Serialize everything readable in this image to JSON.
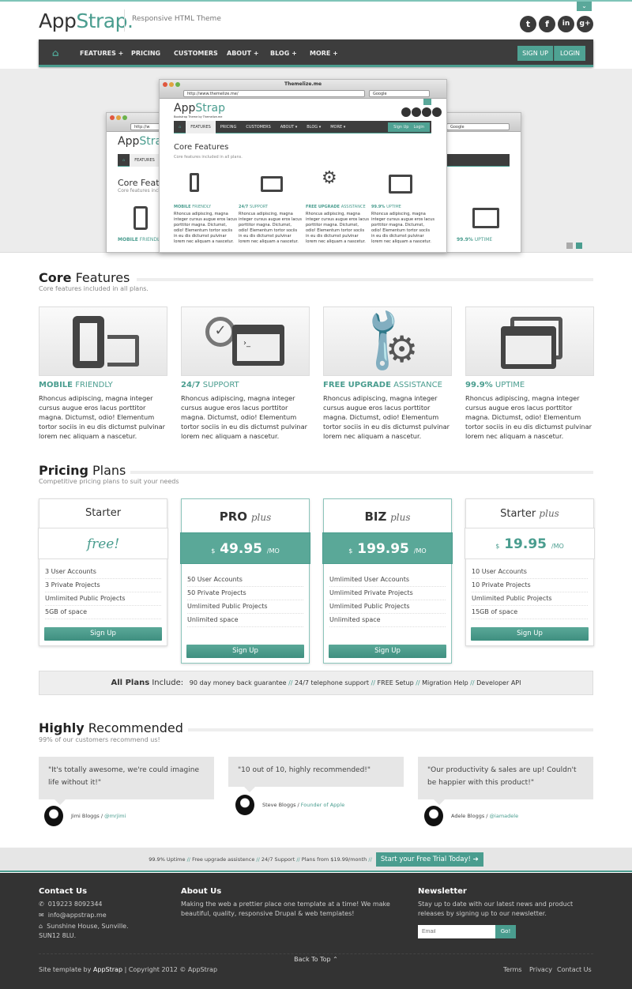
{
  "brand": {
    "logo_a": "App",
    "logo_b": "Strap.",
    "tagline": "Responsive HTML Theme",
    "accent": "#4a9d8f"
  },
  "social": [
    {
      "icon": "twitter-icon",
      "glyph": "t"
    },
    {
      "icon": "facebook-icon",
      "glyph": "f"
    },
    {
      "icon": "linkedin-icon",
      "glyph": "in"
    },
    {
      "icon": "googleplus-icon",
      "glyph": "g+"
    }
  ],
  "nav": {
    "items": [
      "FEATURES +",
      "PRICING",
      "CUSTOMERS",
      "ABOUT +",
      "BLOG +",
      "MORE +"
    ],
    "signup": "SIGN UP",
    "login": "LOGIN"
  },
  "hero": {
    "window_title": "Themelize.me",
    "url": "http://www.themelize.me/",
    "search": "Google",
    "mini_logo_a": "App",
    "mini_logo_b": "Strap",
    "mini_tagline": "Bootstrap Theme by Themelize.me",
    "mini_nav": [
      "FEATURES",
      "PRICING",
      "CUSTOMERS",
      "ABOUT ▾",
      "BLOG ▾",
      "MORE ▾"
    ],
    "mini_signup": "Sign Up",
    "mini_login": "Login",
    "mini_heading": "Core Features",
    "mini_sub": "Core features included in all plans.",
    "mini_features": [
      {
        "a": "MOBILE",
        "b": "FRIENDLY"
      },
      {
        "a": "24/7",
        "b": "SUPPORT"
      },
      {
        "a": "FREE UPGRADE",
        "b": "ASSISTANCE"
      },
      {
        "a": "99.9%",
        "b": "UPTIME"
      }
    ],
    "mini_text": "Rhoncus adipiscing, magna integer cursus augue eros lacus porttitor magna. Dictumst, odio! Elementum tortor sociis in eu dis dictumst pulvinar lorem nec aliquam a nascetur.",
    "back_url": "http://w",
    "back_heading": "Core Featu",
    "back_sub": "Core features includ",
    "back_nav": "FEATURES",
    "back_feature_a": "MOBILE",
    "back_feature_b": "FRIENDLY",
    "back_right_feature_a": "99.9%",
    "back_right_feature_b": "UPTIME",
    "slides": 2,
    "active_slide": 2
  },
  "features": {
    "title_a": "Core",
    "title_b": "Features",
    "subtitle": "Core features included in all plans.",
    "items": [
      {
        "icon": "mobile-tablet-icon",
        "a": "MOBILE",
        "b": "FRIENDLY",
        "text": "Rhoncus adipiscing, magna integer cursus augue eros lacus porttitor magna. Dictumst, odio! Elementum tortor sociis in eu dis dictumst pulvinar lorem nec aliquam a nascetur."
      },
      {
        "icon": "clock-terminal-icon",
        "a": "24/7",
        "b": "SUPPORT",
        "text": "Rhoncus adipiscing, magna integer cursus augue eros lacus porttitor magna. Dictumst, odio! Elementum tortor sociis in eu dis dictumst pulvinar lorem nec aliquam a nascetur."
      },
      {
        "icon": "wrench-gear-icon",
        "a": "FREE UPGRADE",
        "b": "ASSISTANCE",
        "text": "Rhoncus adipiscing, magna integer cursus augue eros lacus porttitor magna. Dictumst, odio! Elementum tortor sociis in eu dis dictumst pulvinar lorem nec aliquam a nascetur."
      },
      {
        "icon": "browser-windows-icon",
        "a": "99.9%",
        "b": "UPTIME",
        "text": "Rhoncus adipiscing, magna integer cursus augue eros lacus porttitor magna. Dictumst, odio! Elementum tortor sociis in eu dis dictumst pulvinar lorem nec aliquam a nascetur."
      }
    ]
  },
  "pricing": {
    "title_a": "Pricing",
    "title_b": "Plans",
    "subtitle": "Competitive pricing plans to suit your needs",
    "plans": [
      {
        "name": "Starter",
        "plus": "",
        "price": "free!",
        "currency": "",
        "per": "",
        "featured": false,
        "features": [
          "3 User Accounts",
          "3 Private Projects",
          "Umlimited Public Projects",
          "5GB of space"
        ],
        "button": "Sign Up"
      },
      {
        "name": "PRO",
        "plus": "plus",
        "price": "49.95",
        "currency": "$",
        "per": "/MO",
        "featured": true,
        "features": [
          "50 User Accounts",
          "50 Private Projects",
          "Umlimited Public Projects",
          "Unlimited space"
        ],
        "button": "Sign Up"
      },
      {
        "name": "BIZ",
        "plus": "plus",
        "price": "199.95",
        "currency": "$",
        "per": "/MO",
        "featured": true,
        "features": [
          "Umlimited User Accounts",
          "Umlimited Private Projects",
          "Umlimited Public Projects",
          "Unlimited space"
        ],
        "button": "Sign Up"
      },
      {
        "name": "Starter",
        "plus": "plus",
        "price": "19.95",
        "currency": "$",
        "per": "/MO",
        "featured": false,
        "features": [
          "10 User Accounts",
          "10 Private Projects",
          "Umlimited Public Projects",
          "15GB of space"
        ],
        "button": "Sign Up"
      }
    ],
    "all_plans_label_a": "All Plans",
    "all_plans_label_b": " Include:",
    "all_plans": [
      "90 day money back guarantee",
      "24/7 telephone support",
      "FREE Setup",
      "Migration Help",
      "Developer API"
    ],
    "sep": "//"
  },
  "testimonials": {
    "title_a": "Highly",
    "title_b": "Recommended",
    "subtitle": "99% of our customers recommend us!",
    "items": [
      {
        "quote": "\"It's totally awesome, we're could imagine life without it!\"",
        "name": "Jimi Bloggs",
        "handle": "@mrjimi"
      },
      {
        "quote": "\"10 out of 10, highly recommended!\"",
        "name": "Steve Bloggs",
        "handle": "Founder of Apple"
      },
      {
        "quote": "\"Our productivity & sales are up! Couldn't be happier with this product!\"",
        "name": "Adele Bloggs",
        "handle": "@iamadele"
      }
    ]
  },
  "cta": {
    "items": [
      "99.9% Uptime",
      "Free upgrade assistence",
      "24/7 Support",
      "Plans from $19.99/month"
    ],
    "button": "Start your Free Trial Today! ➔"
  },
  "footer": {
    "contact_title": "Contact Us",
    "phone": "019223 8092344",
    "email": "info@appstrap.me",
    "address": "Sunshine House, Sunville. SUN12 8LU.",
    "about_title": "About Us",
    "about_text": "Making the web a prettier place one template at a time! We make beautiful, quality, responsive Drupal & web templates!",
    "newsletter_title": "Newsletter",
    "newsletter_text": "Stay up to date with our latest news and product releases by signing up to our newsletter.",
    "email_placeholder": "Email",
    "go": "Go!",
    "back_to_top": "Back To Top ⌃",
    "credit_a": "Site template by ",
    "credit_b": "AppStrap",
    "credit_c": " | Copyright 2012 © AppStrap",
    "links": [
      "Terms",
      "Privacy",
      "Contact Us"
    ]
  }
}
